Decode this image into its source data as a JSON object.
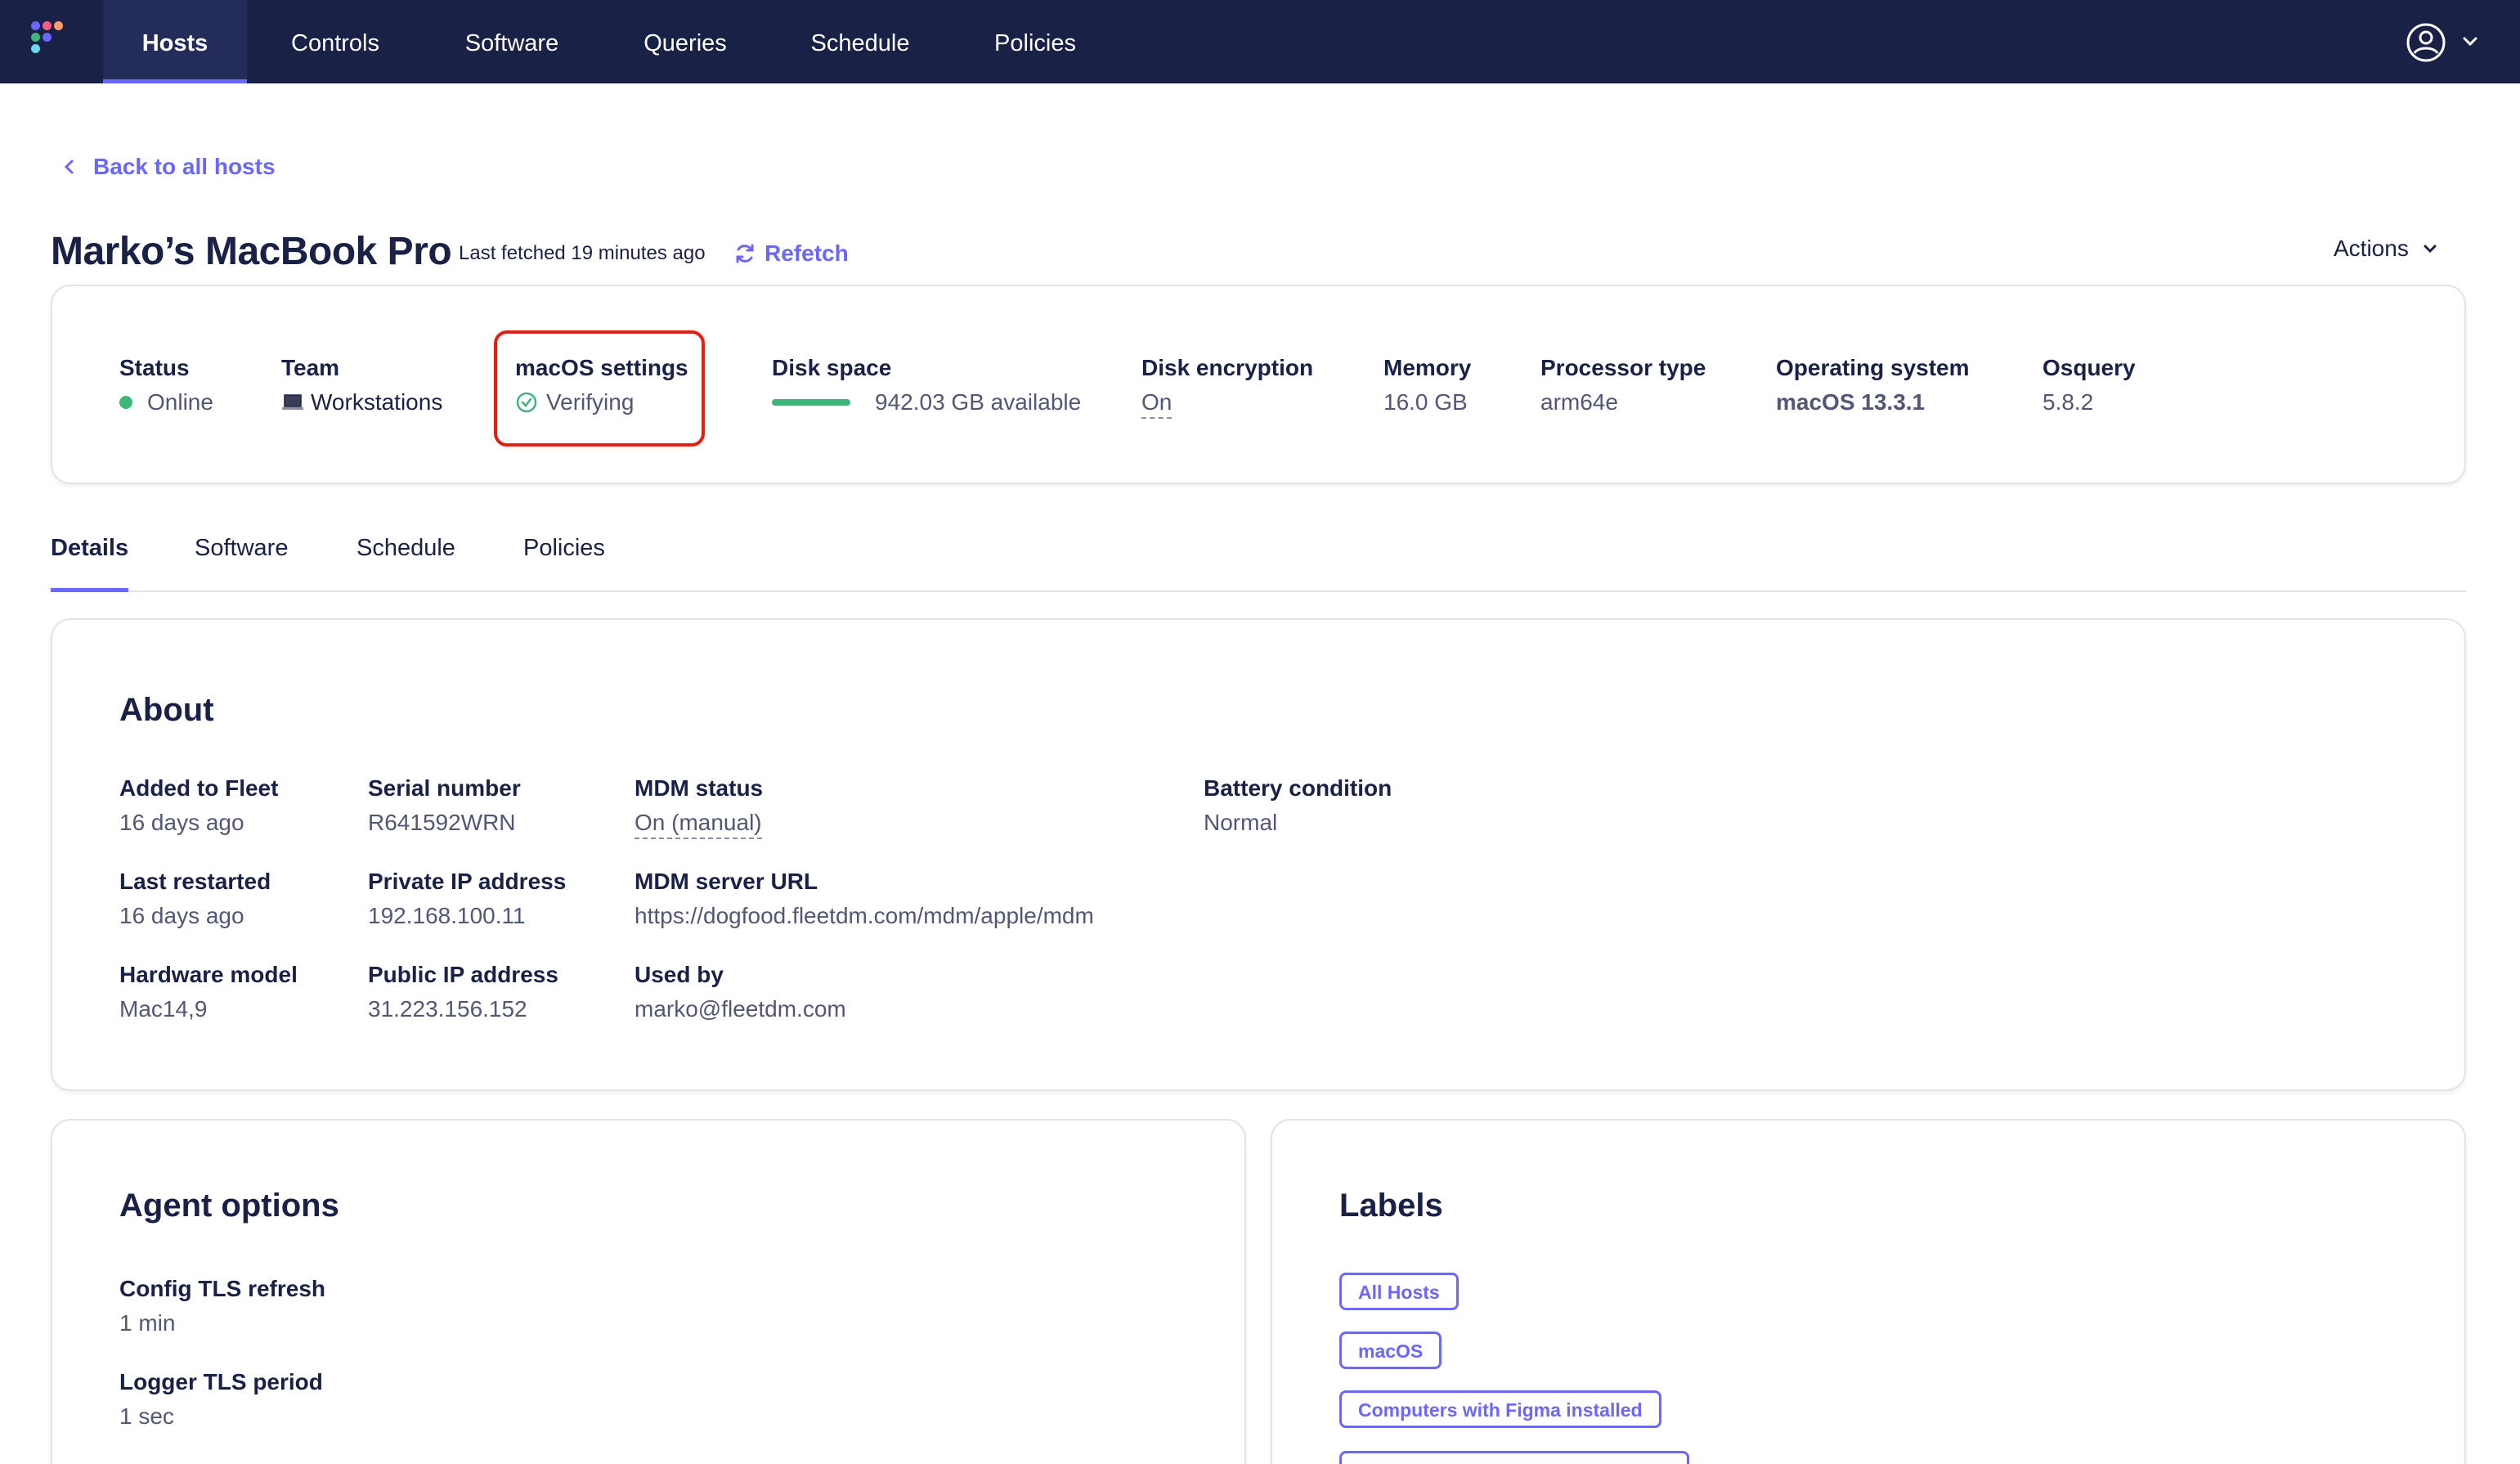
{
  "nav": {
    "items": [
      {
        "label": "Hosts",
        "active": true
      },
      {
        "label": "Controls"
      },
      {
        "label": "Software"
      },
      {
        "label": "Queries"
      },
      {
        "label": "Schedule"
      },
      {
        "label": "Policies"
      }
    ]
  },
  "back_link": "Back to all hosts",
  "header": {
    "title": "Marko’s MacBook Pro",
    "last_fetched": "Last fetched 19 minutes ago",
    "refetch": "Refetch",
    "actions": "Actions"
  },
  "summary": {
    "status": {
      "label": "Status",
      "value": "Online"
    },
    "team": {
      "label": "Team",
      "value": "Workstations"
    },
    "macos_settings": {
      "label": "macOS settings",
      "value": "Verifying"
    },
    "disk_space": {
      "label": "Disk space",
      "value": "942.03 GB available"
    },
    "disk_encryption": {
      "label": "Disk encryption",
      "value": "On"
    },
    "memory": {
      "label": "Memory",
      "value": "16.0 GB"
    },
    "processor": {
      "label": "Processor type",
      "value": "arm64e"
    },
    "os": {
      "label": "Operating system",
      "value": "macOS 13.3.1"
    },
    "osquery": {
      "label": "Osquery",
      "value": "5.8.2"
    }
  },
  "tabs": [
    "Details",
    "Software",
    "Schedule",
    "Policies"
  ],
  "about": {
    "title": "About",
    "added": {
      "label": "Added to Fleet",
      "value": "16 days ago"
    },
    "restarted": {
      "label": "Last restarted",
      "value": "16 days ago"
    },
    "hardware": {
      "label": "Hardware model",
      "value": "Mac14,9"
    },
    "serial": {
      "label": "Serial number",
      "value": "R641592WRN"
    },
    "private_ip": {
      "label": "Private IP address",
      "value": "192.168.100.11"
    },
    "public_ip": {
      "label": "Public IP address",
      "value": "31.223.156.152"
    },
    "mdm_status": {
      "label": "MDM status",
      "value": "On (manual)"
    },
    "mdm_url": {
      "label": "MDM server URL",
      "value": "https://dogfood.fleetdm.com/mdm/apple/mdm"
    },
    "used_by": {
      "label": "Used by",
      "value": "marko@fleetdm.com"
    },
    "battery": {
      "label": "Battery condition",
      "value": "Normal"
    }
  },
  "agent": {
    "title": "Agent options",
    "config_tls": {
      "label": "Config TLS refresh",
      "value": "1 min"
    },
    "logger_tls": {
      "label": "Logger TLS period",
      "value": "1 sec"
    }
  },
  "labels": {
    "title": "Labels",
    "items": [
      "All Hosts",
      "macOS",
      "Computers with Figma installed"
    ]
  },
  "colors": {
    "nav_bg": "#192147",
    "accent": "#6a67fe",
    "online": "#3db67b",
    "highlight": "#e51d14"
  }
}
